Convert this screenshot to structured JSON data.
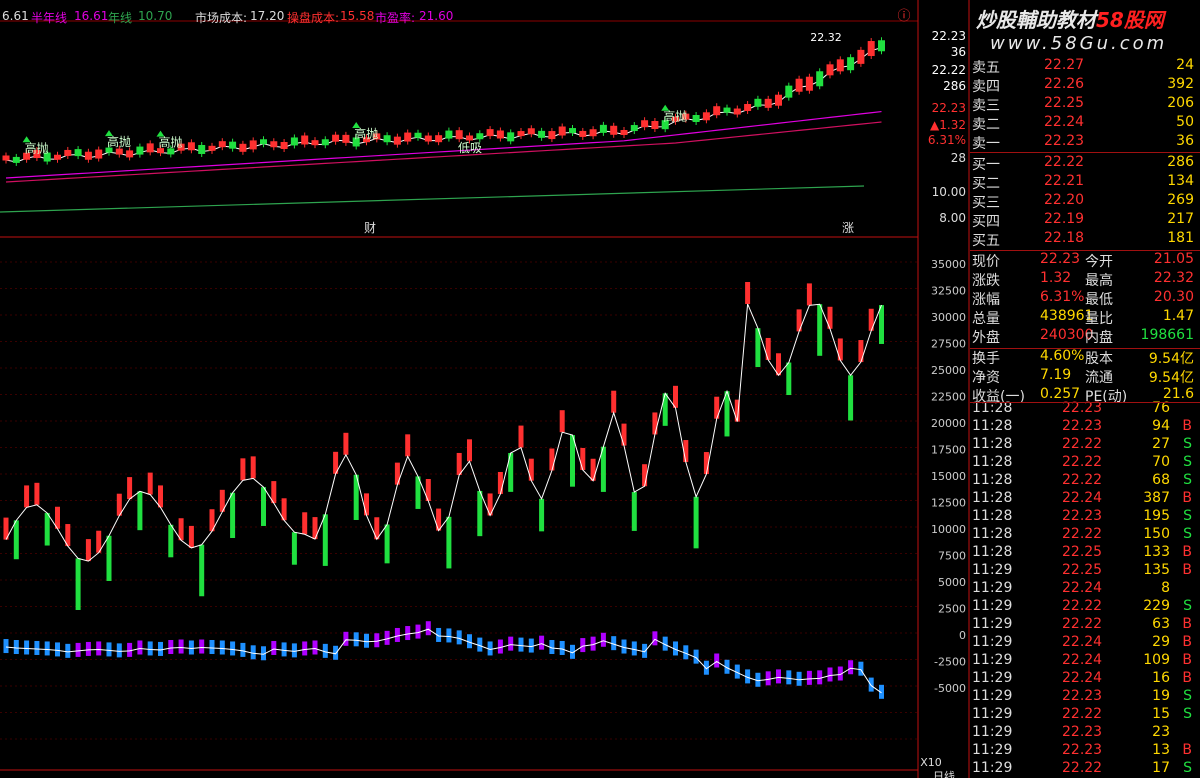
{
  "header": {
    "first_value": "6.61",
    "half_year_label": "半年线",
    "half_year_value": "16.61",
    "year_label": "年线",
    "year_value": "10.70",
    "market_cost_label": "市场成本:",
    "market_cost_value": "17.20",
    "operator_cost_label": "操盘成本:",
    "operator_cost_value": "15.58",
    "pe_label": "市盈率:",
    "pe_value": "21.60"
  },
  "watermark": {
    "line1": "炒股輔助教材",
    "brand": "58股网",
    "line2": "www.58Gu.com"
  },
  "chart_labels": {
    "gaopao": "高抛",
    "dixi": "低吸",
    "cai": "财",
    "zhang": "涨",
    "peak_price": "22.32",
    "x10": "X10",
    "corner": "ⓘ",
    "bottom_corner": "日线"
  },
  "right_axis": {
    "price_ticks": [
      "22.23",
      "36",
      "22.22",
      "286",
      "22.23",
      "▲1.32",
      "6.31%",
      "28",
      "10.00",
      "8.00"
    ],
    "vol_ticks": [
      "35000",
      "32500",
      "30000",
      "27500",
      "25000",
      "22500",
      "20000",
      "17500",
      "15000",
      "12500",
      "10000",
      "7500",
      "5000",
      "2500",
      "0",
      "-2500",
      "-5000"
    ]
  },
  "orderbook": {
    "sell": [
      {
        "label": "卖五",
        "price": "22.27",
        "vol": "24"
      },
      {
        "label": "卖四",
        "price": "22.26",
        "vol": "392"
      },
      {
        "label": "卖三",
        "price": "22.25",
        "vol": "206"
      },
      {
        "label": "卖二",
        "price": "22.24",
        "vol": "50"
      },
      {
        "label": "卖一",
        "price": "22.23",
        "vol": "36"
      }
    ],
    "buy": [
      {
        "label": "买一",
        "price": "22.22",
        "vol": "286"
      },
      {
        "label": "买二",
        "price": "22.21",
        "vol": "134"
      },
      {
        "label": "买三",
        "price": "22.20",
        "vol": "269"
      },
      {
        "label": "买四",
        "price": "22.19",
        "vol": "217"
      },
      {
        "label": "买五",
        "price": "22.18",
        "vol": "181"
      }
    ]
  },
  "quote": [
    {
      "l1": "现价",
      "v1": "22.23",
      "l2": "今开",
      "v2": "21.05"
    },
    {
      "l1": "涨跌",
      "v1": "1.32",
      "l2": "最高",
      "v2": "22.32"
    },
    {
      "l1": "涨幅",
      "v1": "6.31%",
      "l2": "最低",
      "v2": "20.30"
    },
    {
      "l1": "总量",
      "v1": "438961",
      "l2": "量比",
      "v2": "1.47"
    },
    {
      "l1": "外盘",
      "v1": "240300",
      "l2": "内盘",
      "v2": "198661"
    }
  ],
  "fundamentals": [
    {
      "l1": "换手",
      "v1": "4.60%",
      "l2": "股本",
      "v2": "9.54亿"
    },
    {
      "l1": "净资",
      "v1": "7.19",
      "l2": "流通",
      "v2": "9.54亿"
    },
    {
      "l1": "收益(一)",
      "v1": "0.257",
      "l2": "PE(动)",
      "v2": "21.6"
    }
  ],
  "ticks": [
    {
      "time": "11:28",
      "price": "22.23",
      "vol": "76",
      "side": ""
    },
    {
      "time": "11:28",
      "price": "22.23",
      "vol": "94",
      "side": "B"
    },
    {
      "time": "11:28",
      "price": "22.22",
      "vol": "27",
      "side": "S"
    },
    {
      "time": "11:28",
      "price": "22.22",
      "vol": "70",
      "side": "S"
    },
    {
      "time": "11:28",
      "price": "22.22",
      "vol": "68",
      "side": "S"
    },
    {
      "time": "11:28",
      "price": "22.24",
      "vol": "387",
      "side": "B"
    },
    {
      "time": "11:28",
      "price": "22.23",
      "vol": "195",
      "side": "S"
    },
    {
      "time": "11:28",
      "price": "22.22",
      "vol": "150",
      "side": "S"
    },
    {
      "time": "11:28",
      "price": "22.25",
      "vol": "133",
      "side": "B"
    },
    {
      "time": "11:29",
      "price": "22.25",
      "vol": "135",
      "side": "B"
    },
    {
      "time": "11:29",
      "price": "22.24",
      "vol": "8",
      "side": ""
    },
    {
      "time": "11:29",
      "price": "22.22",
      "vol": "229",
      "side": "S"
    },
    {
      "time": "11:29",
      "price": "22.22",
      "vol": "63",
      "side": "B"
    },
    {
      "time": "11:29",
      "price": "22.24",
      "vol": "29",
      "side": "B"
    },
    {
      "time": "11:29",
      "price": "22.24",
      "vol": "109",
      "side": "B"
    },
    {
      "time": "11:29",
      "price": "22.24",
      "vol": "16",
      "side": "B"
    },
    {
      "time": "11:29",
      "price": "22.23",
      "vol": "19",
      "side": "S"
    },
    {
      "time": "11:29",
      "price": "22.22",
      "vol": "15",
      "side": "S"
    },
    {
      "time": "11:29",
      "price": "22.23",
      "vol": "23",
      "side": ""
    },
    {
      "time": "11:29",
      "price": "22.23",
      "vol": "13",
      "side": "B"
    },
    {
      "time": "11:29",
      "price": "22.22",
      "vol": "17",
      "side": "S"
    }
  ],
  "colors": {
    "up": "#ff3030",
    "down": "#20e040",
    "sell": "#b000ff",
    "buyflow": "#1e90ff",
    "grid": "#8b0000",
    "magenta": "#e000e0",
    "ma_green": "#2ea44f",
    "text_yellow": "#ffd800"
  },
  "flow_values": [
    -2500,
    -2700,
    -2800,
    -2900,
    -3000,
    -3200,
    -3500,
    -3300,
    -3100,
    -3000,
    -3200,
    -3400,
    -3300,
    -2800,
    -3000,
    -3100,
    -2700,
    -2600,
    -2800,
    -2600,
    -2700,
    -2800,
    -3000,
    -3300,
    -3800,
    -4000,
    -2900,
    -3200,
    -3400,
    -3000,
    -2800,
    -3500,
    -3900,
    -1000,
    -1100,
    -1400,
    -1300,
    -800,
    -200,
    200,
    500,
    1200,
    -200,
    -300,
    -700,
    -1500,
    -2200,
    -3000,
    -2600,
    -2000,
    -2200,
    -2400,
    -1800,
    -2700,
    -2900,
    -3700,
    -2300,
    -2000,
    -1200,
    -1900,
    -2600,
    -3000,
    -3500,
    -900,
    -2000,
    -3000,
    -3800,
    -4700,
    -7000,
    -5500,
    -6800,
    -7800,
    -8800,
    -9500,
    -9200,
    -8800,
    -9000,
    -9300,
    -9100,
    -9000,
    -8400,
    -8200,
    -6900,
    -7200,
    -10500,
    -12000
  ]
}
